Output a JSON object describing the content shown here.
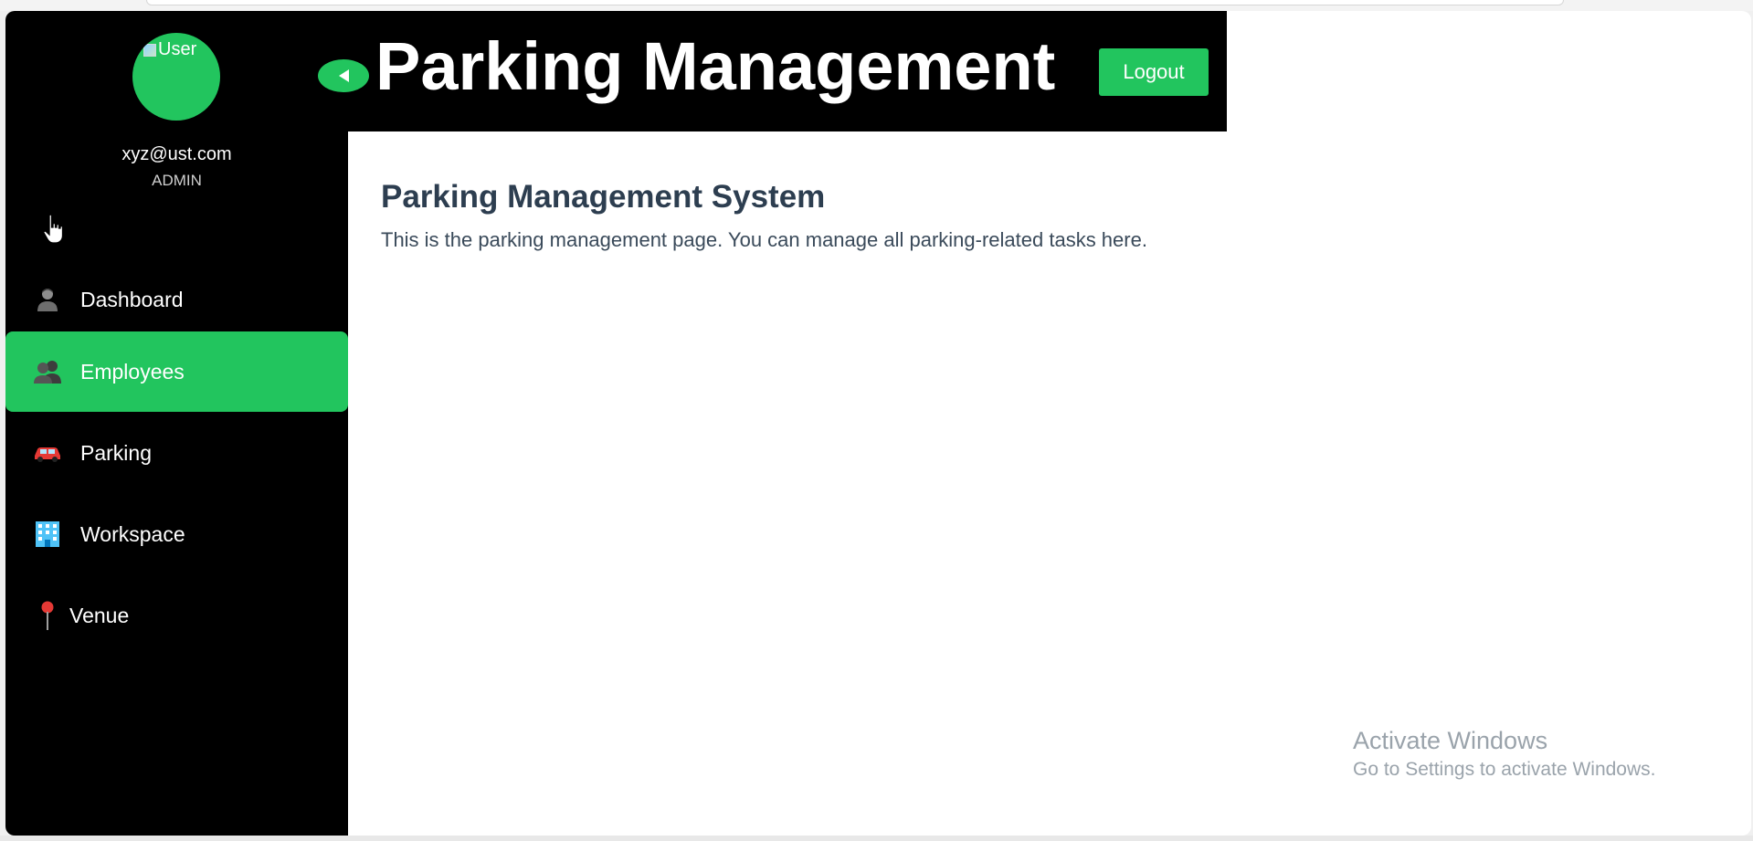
{
  "user": {
    "avatar_alt": "User",
    "email": "xyz@ust.com",
    "role": "ADMIN"
  },
  "sidebar": {
    "items": [
      {
        "label": "Dashboard",
        "icon": "person-icon",
        "active": false
      },
      {
        "label": "Employees",
        "icon": "people-icon",
        "active": true
      },
      {
        "label": "Parking",
        "icon": "car-icon",
        "active": false
      },
      {
        "label": "Workspace",
        "icon": "office-building-icon",
        "active": false
      },
      {
        "label": "Venue",
        "icon": "pin-icon",
        "active": false
      }
    ]
  },
  "header": {
    "title": "Parking Management",
    "logout_label": "Logout"
  },
  "main": {
    "heading": "Parking Management System",
    "description": "This is the parking management page. You can manage all parking-related tasks here."
  },
  "watermark": {
    "title": "Activate Windows",
    "subtitle": "Go to Settings to activate Windows."
  },
  "colors": {
    "accent": "#22c55e",
    "sidebar_bg": "#000000",
    "heading": "#2d3e50"
  }
}
